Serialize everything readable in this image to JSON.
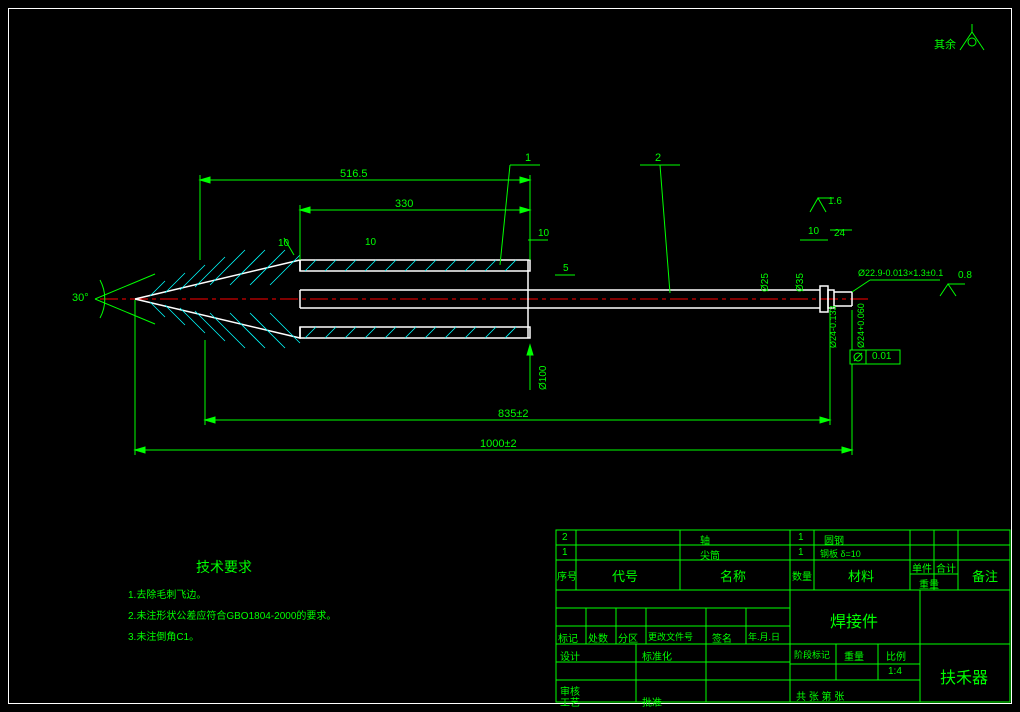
{
  "domain": "Diagram",
  "surface_finish_label": "其余",
  "callouts": {
    "one": "1",
    "two": "2"
  },
  "dimensions": {
    "d_516_5": "516.5",
    "d_330": "330",
    "d_10a": "10",
    "d_10b": "10",
    "d_10c": "10",
    "d_5": "5",
    "angle_30": "30°",
    "phi25": "Ø25",
    "phi35": "Ø35",
    "d_24": "24",
    "surf_1_6": "1.6",
    "surf_0_8": "0.8",
    "thread": "Ø22.9-0.013×1.3±0.1",
    "d_835": "835±2",
    "d_1000": "1000±2",
    "tol_001": "0.01",
    "phi24_tol": "Ø24-0.133",
    "phi24_tol2": "Ø24+0.060",
    "phi100": "Ø100"
  },
  "tech_req": {
    "title": "技术要求",
    "items": [
      "1.去除毛刺飞边。",
      "2.未注形状公差应符合GBO1804-2000的要求。",
      "3.未注倒角C1。"
    ]
  },
  "bom": {
    "rows": [
      {
        "no": "2",
        "code": "",
        "name": "轴",
        "qty": "1",
        "material": "圆钢",
        "unit": "",
        "total": "",
        "remark": ""
      },
      {
        "no": "1",
        "code": "",
        "name": "尖筒",
        "qty": "1",
        "material": "钢板 δ=10",
        "unit": "",
        "total": "",
        "remark": ""
      }
    ],
    "headers": {
      "no": "序号",
      "code": "代号",
      "name": "名称",
      "qty": "数量",
      "material": "材料",
      "unit": "单件",
      "total": "合计",
      "remark": "备注",
      "weight": "重量"
    }
  },
  "titleblock": {
    "mark": "标记",
    "chgs": "处数",
    "zone": "分区",
    "docno": "更改文件号",
    "sign": "签名",
    "date": "年.月.日",
    "design": "设计",
    "std": "标准化",
    "check": "审核",
    "process": "工艺",
    "approve": "批准",
    "stage": "阶段标记",
    "mass": "重量",
    "scale": "比例",
    "scale_val": "1:4",
    "main_name": "焊接件",
    "product": "扶禾器",
    "footer": "共      张     第      张"
  }
}
